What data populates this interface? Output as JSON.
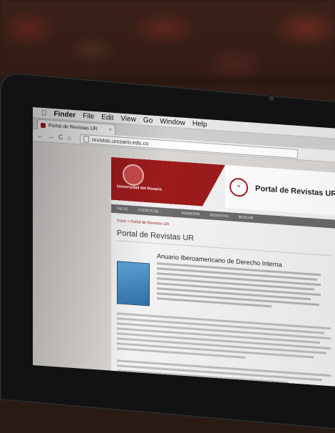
{
  "menubar": {
    "apple": "",
    "items": [
      "Finder",
      "File",
      "Edit",
      "View",
      "Go",
      "Window",
      "Help"
    ]
  },
  "browser": {
    "tab_label": "Portal de Revistas UR",
    "tab_close": "×",
    "url": "revistas.urosario.edu.co",
    "nav": {
      "back": "←",
      "forward": "→",
      "reload": "C",
      "home": "⌂"
    }
  },
  "site": {
    "university": "Universidad del Rosario",
    "portal_title": "Portal de Revistas UR",
    "nav_items": [
      "INICIO",
      "ACERCA DE...",
      "",
      "INGRESAR",
      "REGISTRO",
      "BUSCAR"
    ],
    "breadcrumb": "Inicio > Portal de Revistas UR",
    "page_title": "Portal de Revistas UR",
    "journal_title": "Anuario Iberoamericano de Derecho Interna"
  },
  "colors": {
    "brand_red": "#9c1b1b",
    "nav_gray": "#6b6b6b"
  }
}
